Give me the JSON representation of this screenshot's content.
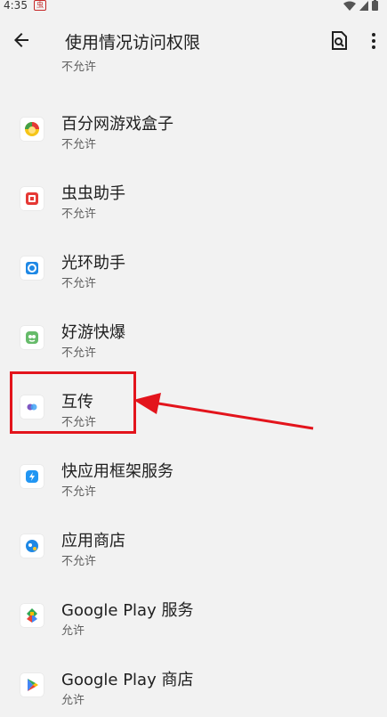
{
  "status_bar": {
    "time": "4:35",
    "app_icon_char": "虫"
  },
  "header": {
    "title": "使用情况访问权限"
  },
  "partial_item": {
    "status": "不允许"
  },
  "apps": [
    {
      "name": "百分网游戏盒子",
      "status": "不允许",
      "icon": "baifen-game-box-icon"
    },
    {
      "name": "虫虫助手",
      "status": "不允许",
      "icon": "chongchong-assistant-icon"
    },
    {
      "name": "光环助手",
      "status": "不允许",
      "icon": "guanghuan-assistant-icon"
    },
    {
      "name": "好游快爆",
      "status": "不允许",
      "icon": "haoyou-kuaibao-icon"
    },
    {
      "name": "互传",
      "status": "不允许",
      "icon": "huchuan-icon"
    },
    {
      "name": "快应用框架服务",
      "status": "不允许",
      "icon": "quick-app-framework-icon"
    },
    {
      "name": "应用商店",
      "status": "不允许",
      "icon": "app-store-icon"
    },
    {
      "name": "Google Play 服务",
      "status": "允许",
      "icon": "google-play-services-icon"
    },
    {
      "name": "Google Play 商店",
      "status": "允许",
      "icon": "google-play-store-icon"
    }
  ],
  "annotation": {
    "color": "#e3141c",
    "highlighted_app": "互传"
  }
}
